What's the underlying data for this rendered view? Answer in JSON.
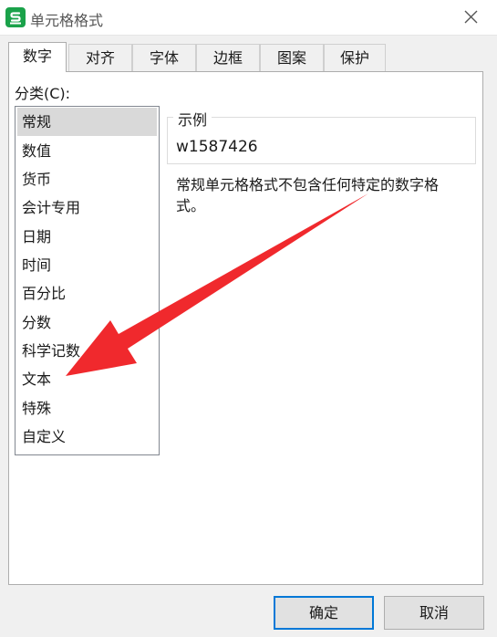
{
  "window": {
    "title": "单元格格式",
    "icon": "spreadsheet-app-icon",
    "close_icon": "close-icon"
  },
  "tabs": [
    {
      "label": "数字",
      "active": true
    },
    {
      "label": "对齐",
      "active": false
    },
    {
      "label": "字体",
      "active": false
    },
    {
      "label": "边框",
      "active": false
    },
    {
      "label": "图案",
      "active": false
    },
    {
      "label": "保护",
      "active": false
    }
  ],
  "category": {
    "label": "分类(C):",
    "items": [
      "常规",
      "数值",
      "货币",
      "会计专用",
      "日期",
      "时间",
      "百分比",
      "分数",
      "科学记数",
      "文本",
      "特殊",
      "自定义"
    ],
    "selected": "常规"
  },
  "sample": {
    "legend": "示例",
    "value": "w1587426"
  },
  "description": "常规单元格格式不包含任何特定的数字格式。",
  "buttons": {
    "ok": "确定",
    "cancel": "取消"
  },
  "colors": {
    "app_icon": "#1aa24a",
    "annotation_arrow": "#f0292d",
    "default_button_border": "#0078d7",
    "selected_item": "#d9d9d9"
  }
}
